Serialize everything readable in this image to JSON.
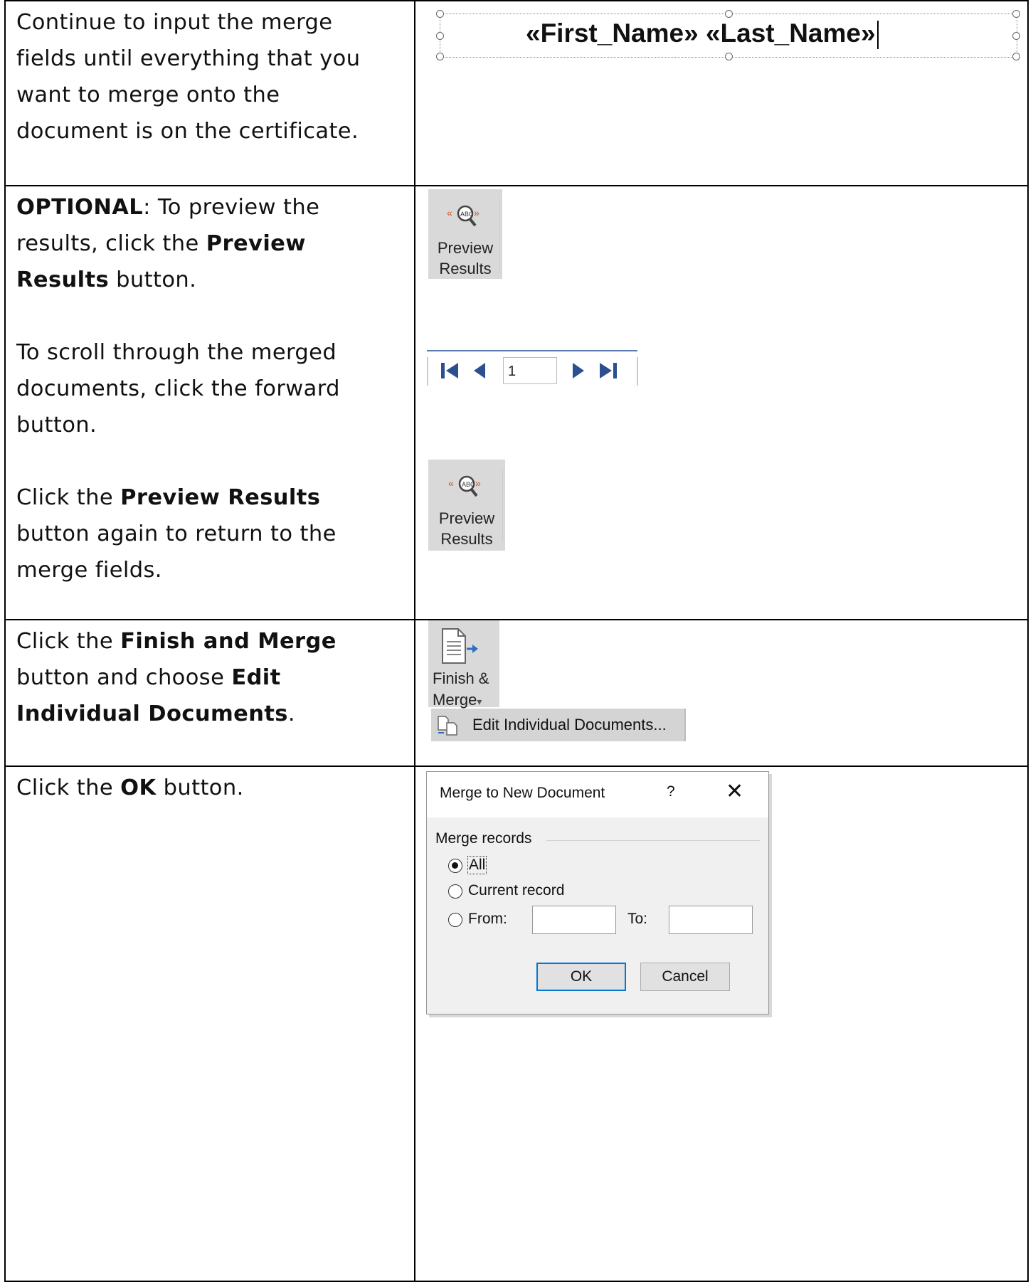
{
  "rows": [
    {
      "text": [
        "Continue to input the merge",
        "fields until everything that you",
        "want to merge onto the",
        "document is on the certificate."
      ],
      "merge_fields": "«First_Name» «Last_Name»"
    },
    {
      "optional_bold": "OPTIONAL",
      "optional_rest": ": To preview the",
      "preview_line2_a": "results, click the ",
      "preview_line2_b": "Preview",
      "preview_line3_a": "Results",
      "preview_line3_b": " button.",
      "scroll_text": [
        "To scroll through the merged",
        "documents, click the forward",
        "button."
      ],
      "click_a": "Click the ",
      "click_b": "Preview Results",
      "again_text": [
        "button again to return to the",
        "merge fields."
      ],
      "preview_button_line1": "Preview",
      "preview_button_line2": "Results",
      "record_number": "1"
    },
    {
      "l1_a": "Click the ",
      "l1_b": "Finish and Merge",
      "l2_a": "button and choose ",
      "l2_b": "Edit",
      "l3_a": "Individual Documents",
      "l3_b": ".",
      "finish_line1": "Finish &",
      "finish_line2": "Merge",
      "dropdown_arrow": "▾",
      "menu_item": "Edit Individual Documents..."
    },
    {
      "l1_a": "Click the ",
      "l1_b": "OK",
      "l1_c": " button.",
      "dialog": {
        "title": "Merge to New Document",
        "help": "?",
        "close": "✕",
        "group": "Merge records",
        "all": "All",
        "current": "Current record",
        "from": "From:",
        "to": "To:",
        "ok": "OK",
        "cancel": "Cancel"
      }
    }
  ],
  "colors": {
    "border": "#000000",
    "ribbon_gray": "#d9d9d9",
    "nav_blue": "#2b4f8f",
    "accent_blue": "#0078d7",
    "icon_orange": "#d0532b"
  }
}
